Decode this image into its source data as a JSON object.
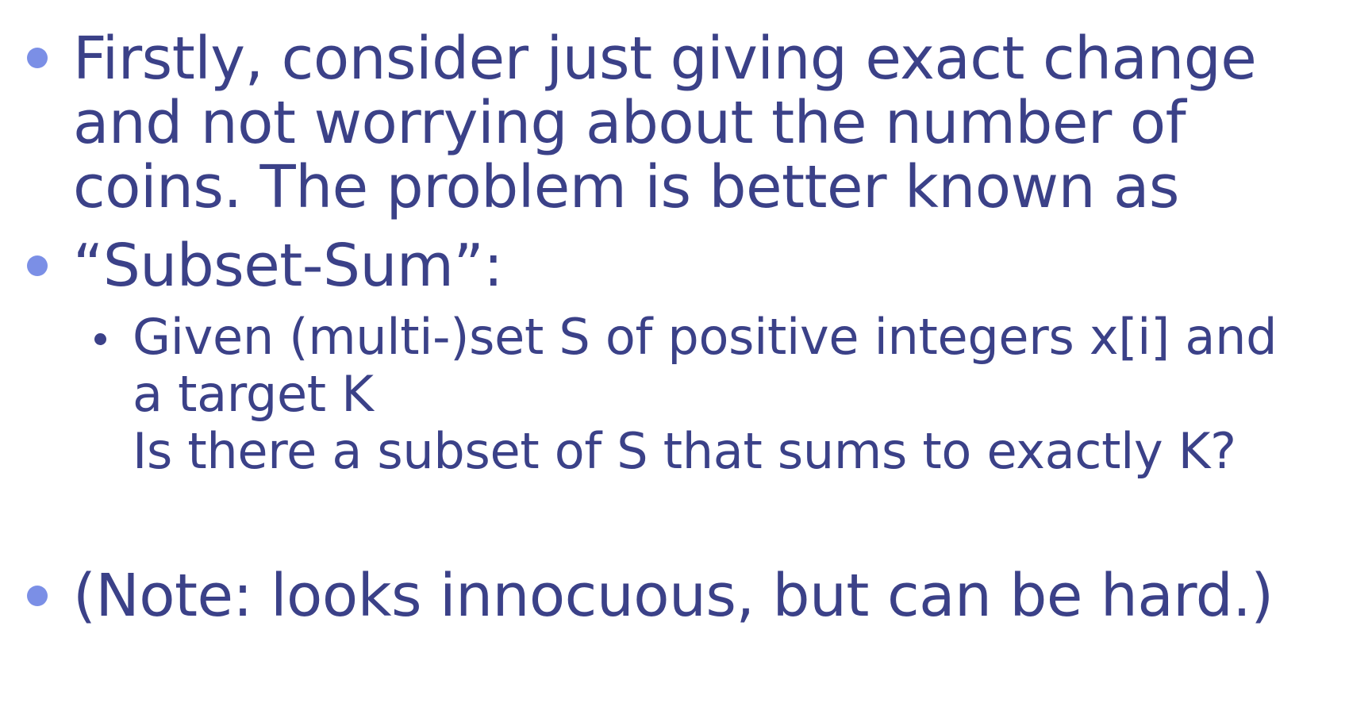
{
  "slide": {
    "bullets": [
      {
        "level": 1,
        "lines": [
          "Firstly, consider just giving exact change",
          "and not worrying about the number of",
          "coins.  The problem is better known as"
        ]
      },
      {
        "level": 1,
        "lines": [
          "“Subset-Sum”:"
        ]
      },
      {
        "level": 2,
        "lines": [
          "Given (multi-)set S of positive integers x[i] and",
          "a target K",
          "Is there a subset of S that sums to exactly K?"
        ]
      },
      {
        "level": 1,
        "lines": [
          "(Note: looks innocuous, but can be hard.)"
        ]
      }
    ]
  },
  "colors": {
    "text": "#3b4188",
    "level1_bullet": "#7b8fe6",
    "level2_bullet": "#3b4188",
    "background": "#ffffff"
  }
}
